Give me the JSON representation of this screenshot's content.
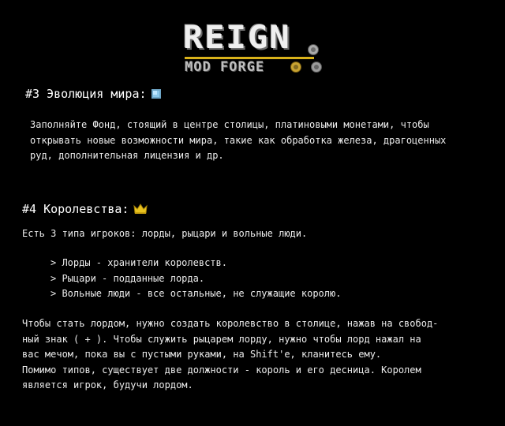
{
  "logo": {
    "title": "REIGN",
    "subtitle": "MOD FORGE"
  },
  "sections": [
    {
      "title": "#3 Эволюция мира:",
      "icon": "diamond-gem-icon",
      "paragraph_lines": [
        "Заполняйте Фонд, стоящий в центре столицы, платиновыми монетами, чтобы",
        "открывать новые возможности мира, такие как обработка железа, драгоценных",
        "руд, дополнительная лицензия и др."
      ]
    },
    {
      "title": "#4 Королевства:",
      "icon": "gold-crown-icon",
      "intro": "Есть 3 типа игроков: лорды, рыцари и вольные люди.",
      "list": [
        "> Лорды - хранители королевств.",
        "> Рыцари - подданные лорда.",
        "> Вольные люди - все остальные, не служащие королю."
      ],
      "paragraph_lines": [
        "Чтобы стать лордом, нужно создать королевство в столице, нажав на свобод-",
        "ный знак ( + ). Чтобы служить рыцарем лорду, нужно чтобы лорд нажал на",
        "вас мечом, пока вы с пустыми руками, на Shift'е, кланитесь ему.",
        "Помимо типов, существует две должности - король и его десница. Королем",
        "является игрок, будучи лордом."
      ]
    }
  ],
  "colors": {
    "background": "#000000",
    "text": "#ececec",
    "logo_accent": "#d9b21a",
    "crown": "#e8c21e",
    "gem": "#bfe7ff"
  }
}
